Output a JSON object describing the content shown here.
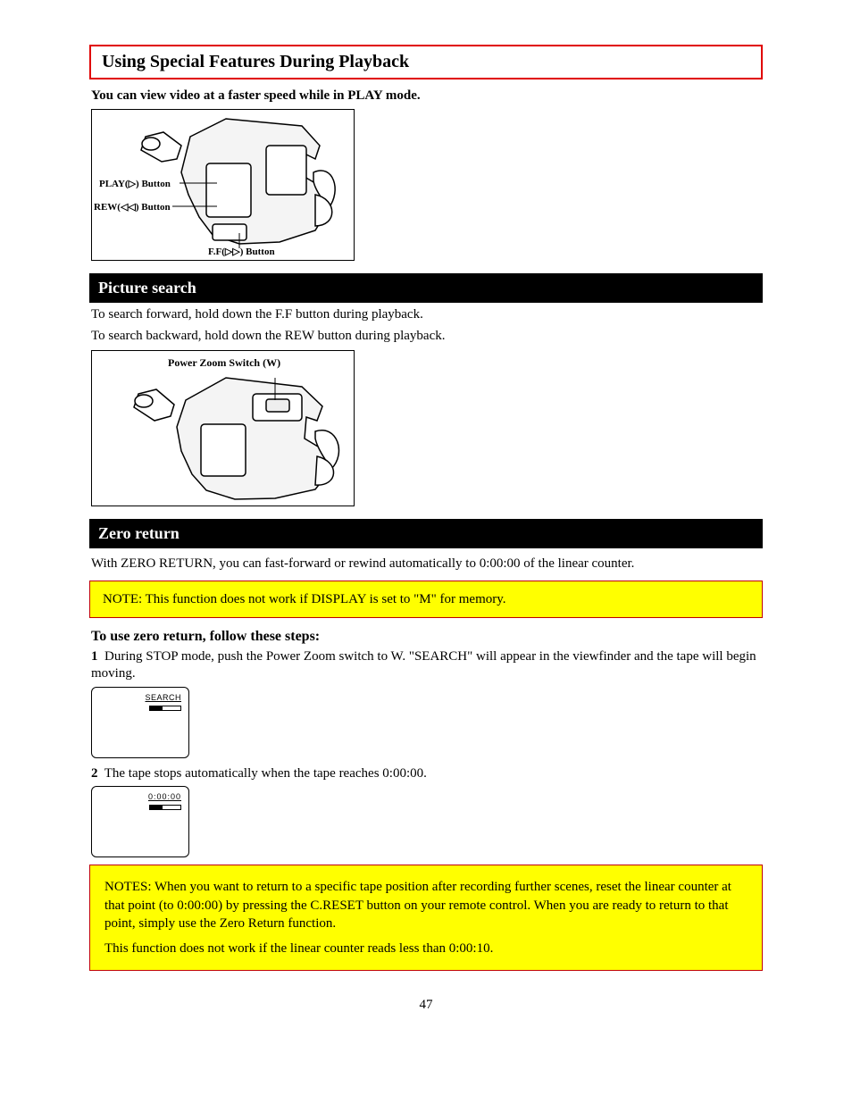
{
  "red_title": "Using Special Features During Playback",
  "intro_bold": "You can view video at a faster speed while in PLAY mode.",
  "fig1": {
    "play_label": "PLAY(▷) Button",
    "rew_label": "REW(◁◁) Button",
    "ff_label": "F.F(▷▷) Button"
  },
  "black_bar_1": "Picture search",
  "search_1": "To search forward, hold down the F.F button during playback.",
  "search_2": "To search backward, hold down the REW button during playback.",
  "fig2": {
    "zoom_label": "Power Zoom Switch (W)"
  },
  "black_bar_2": "Zero return",
  "zero_intro": "With ZERO RETURN, you can fast-forward or rewind automatically to 0:00:00 of the linear counter.",
  "note1": "NOTE: This function does not work if DISPLAY is set to \"M\" for memory.",
  "zero_steps_heading": "To use zero return, follow these steps:",
  "step1_label": "1",
  "step1_text": "During STOP mode, push the Power Zoom switch to W. \"SEARCH\" will appear in the viewfinder and the tape will begin moving.",
  "vf1_label": "SEARCH",
  "step2_label": "2",
  "step2_text": "The tape stops automatically when the tape reaches 0:00:00.",
  "vf2_label": "0:00:00",
  "note2_p1": "NOTES: When you want to return to a specific tape position after recording further scenes, reset the linear counter at that point (to 0:00:00) by pressing the C.RESET button on your remote control. When you are ready to return to that point, simply use the Zero Return function.",
  "note2_p2": "This function does not work if the linear counter reads less than 0:00:10.",
  "page_number": "47"
}
